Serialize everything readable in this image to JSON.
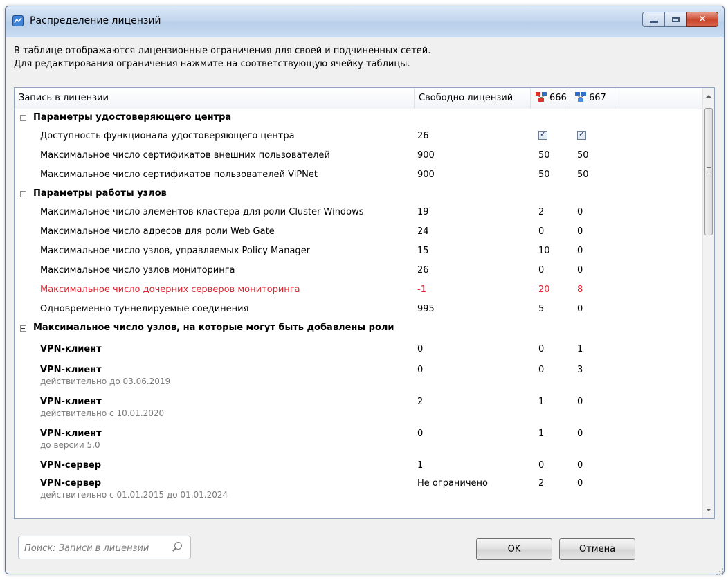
{
  "window": {
    "title": "Распределение лицензий"
  },
  "description": {
    "line1": "В таблице отображаются лицензионные ограничения для своей и подчиненных сетей.",
    "line2": "Для редактирования ограничения нажмите на соответствующую ячейку таблицы."
  },
  "table": {
    "headers": {
      "record": "Запись в лицензии",
      "free": "Свободно лицензий",
      "net1": "666",
      "net2": "667"
    },
    "group1": {
      "title": "Параметры удостоверяющего центра",
      "rows": [
        {
          "name": "Доступность функционала удостоверяющего центра",
          "free": "26",
          "v1": "checked",
          "v2": "checked"
        },
        {
          "name": "Максимальное число сертификатов внешних пользователей",
          "free": "900",
          "v1": "50",
          "v2": "50"
        },
        {
          "name": "Максимальное число сертификатов пользователей ViPNet",
          "free": "900",
          "v1": "50",
          "v2": "50"
        }
      ]
    },
    "group2": {
      "title": "Параметры работы узлов",
      "rows": [
        {
          "name": "Максимальное число элементов кластера для роли Cluster Windows",
          "free": "19",
          "v1": "2",
          "v2": "0"
        },
        {
          "name": "Максимальное число адресов для роли Web Gate",
          "free": "24",
          "v1": "0",
          "v2": "0"
        },
        {
          "name": "Максимальное число узлов, управляемых Policy Manager",
          "free": "15",
          "v1": "10",
          "v2": "0"
        },
        {
          "name": "Максимальное число узлов мониторинга",
          "free": "26",
          "v1": "0",
          "v2": "0"
        },
        {
          "name": "Максимальное число дочерних серверов мониторинга",
          "free": "-1",
          "v1": "20",
          "v2": "8"
        },
        {
          "name": "Одновременно туннелируемые соединения",
          "free": "995",
          "v1": "5",
          "v2": "0"
        }
      ]
    },
    "group3": {
      "title": "Максимальное число узлов, на которые могут быть добавлены роли",
      "rows": [
        {
          "name": "VPN-клиент",
          "sub": "",
          "free": "0",
          "v1": "0",
          "v2": "1"
        },
        {
          "name": "VPN-клиент",
          "sub": "действительно до 03.06.2019",
          "free": "0",
          "v1": "0",
          "v2": "3"
        },
        {
          "name": "VPN-клиент",
          "sub": "действительно с 10.01.2020",
          "free": "2",
          "v1": "1",
          "v2": "0"
        },
        {
          "name": "VPN-клиент",
          "sub": "до версии 5.0",
          "free": "0",
          "v1": "1",
          "v2": "0"
        },
        {
          "name": "VPN-сервер",
          "sub": "",
          "free": "1",
          "v1": "0",
          "v2": "0"
        },
        {
          "name": "VPN-сервер",
          "sub": "действительно с 01.01.2015 до 01.01.2024",
          "free": "Не ограничено",
          "v1": "2",
          "v2": "0"
        }
      ]
    }
  },
  "search": {
    "placeholder": "Поиск: Записи в лицензии",
    "value": ""
  },
  "buttons": {
    "ok": "OK",
    "cancel": "Отмена"
  },
  "colors": {
    "error_row": "#e0202d",
    "title_bar": "#c4d7ee",
    "close_button": "#c9462c"
  }
}
